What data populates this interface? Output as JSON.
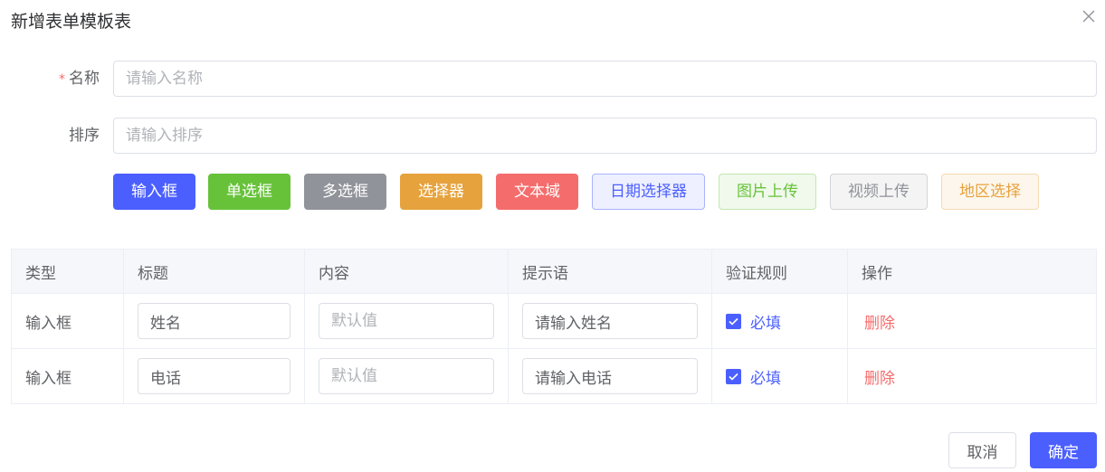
{
  "dialog": {
    "title": "新增表单模板表",
    "close_icon": "close-icon"
  },
  "form": {
    "name": {
      "label": "名称",
      "required_mark": "*",
      "placeholder": "请输入名称",
      "value": ""
    },
    "sort": {
      "label": "排序",
      "placeholder": "请输入排序",
      "value": ""
    }
  },
  "type_buttons": [
    {
      "label": "输入框",
      "style": "solid",
      "color": "#4b5fff"
    },
    {
      "label": "单选框",
      "style": "solid",
      "color": "#67c23a"
    },
    {
      "label": "多选框",
      "style": "solid",
      "color": "#909399"
    },
    {
      "label": "选择器",
      "style": "solid",
      "color": "#e6a23c"
    },
    {
      "label": "文本域",
      "style": "solid",
      "color": "#f56c6c"
    },
    {
      "label": "日期选择器",
      "style": "plain",
      "color": "#4b5fff"
    },
    {
      "label": "图片上传",
      "style": "plain",
      "color": "#67c23a"
    },
    {
      "label": "视频上传",
      "style": "plain",
      "color": "#909399"
    },
    {
      "label": "地区选择",
      "style": "plain",
      "color": "#e6a23c"
    }
  ],
  "table": {
    "headers": [
      "类型",
      "标题",
      "内容",
      "提示语",
      "验证规则",
      "操作"
    ],
    "rows": [
      {
        "type": "输入框",
        "title": "姓名",
        "content": "",
        "content_placeholder": "默认值",
        "hint": "请输入姓名",
        "rule_checked": true,
        "rule_label": "必填",
        "action": "删除"
      },
      {
        "type": "输入框",
        "title": "电话",
        "content": "",
        "content_placeholder": "默认值",
        "hint": "请输入电话",
        "rule_checked": true,
        "rule_label": "必填",
        "action": "删除"
      }
    ]
  },
  "footer": {
    "cancel_label": "取消",
    "confirm_label": "确定"
  },
  "colors": {
    "primary": "#4b5fff",
    "danger": "#f56c6c",
    "border": "#dcdfe6"
  }
}
